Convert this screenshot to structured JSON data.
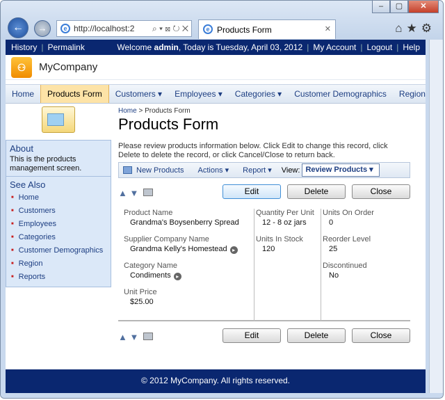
{
  "browser": {
    "address": "http://localhost:2",
    "tab_title": "Products Form",
    "tab_close": "✕",
    "min": "–",
    "max": "▢",
    "close": "✕"
  },
  "topbar": {
    "history": "History",
    "permalink": "Permalink",
    "welcome_prefix": "Welcome ",
    "user": "admin",
    "welcome_suffix": ", Today is Tuesday, April 03, 2012",
    "my_account": "My Account",
    "logout": "Logout",
    "help": "Help"
  },
  "brand": {
    "name": "MyCompany"
  },
  "menu": [
    "Home",
    "Products Form",
    "Customers ▾",
    "Employees ▾",
    "Categories ▾",
    "Customer Demographics",
    "Region"
  ],
  "sidebar": {
    "about_title": "About",
    "about_text": "This is the products management screen.",
    "see_also_title": "See Also",
    "links": [
      "Home",
      "Customers",
      "Employees",
      "Categories",
      "Customer Demographics",
      "Region",
      "Reports"
    ]
  },
  "breadcrumb": {
    "home": "Home",
    "sep": " > ",
    "current": "Products Form"
  },
  "page_title": "Products Form",
  "description": "Please review products information below. Click Edit to change this record, click Delete to delete the record, or click Cancel/Close to return back.",
  "toolbar": {
    "new": "New Products",
    "actions": "Actions ▾",
    "report": "Report ▾",
    "view_label": "View:",
    "view_value": "Review Products  ▾"
  },
  "buttons": {
    "edit": "Edit",
    "delete": "Delete",
    "close": "Close"
  },
  "fields": {
    "product_name_label": "Product Name",
    "product_name": "Grandma's Boysenberry Spread",
    "supplier_label": "Supplier Company Name",
    "supplier": "Grandma Kelly's Homestead",
    "category_label": "Category Name",
    "category": "Condiments",
    "unit_price_label": "Unit Price",
    "unit_price": "$25.00",
    "qty_label": "Quantity Per Unit",
    "qty": "12 - 8 oz jars",
    "stock_label": "Units In Stock",
    "stock": "120",
    "order_label": "Units On Order",
    "order": "0",
    "reorder_label": "Reorder Level",
    "reorder": "25",
    "discontinued_label": "Discontinued",
    "discontinued": "No"
  },
  "footer": "© 2012 MyCompany. All rights reserved."
}
